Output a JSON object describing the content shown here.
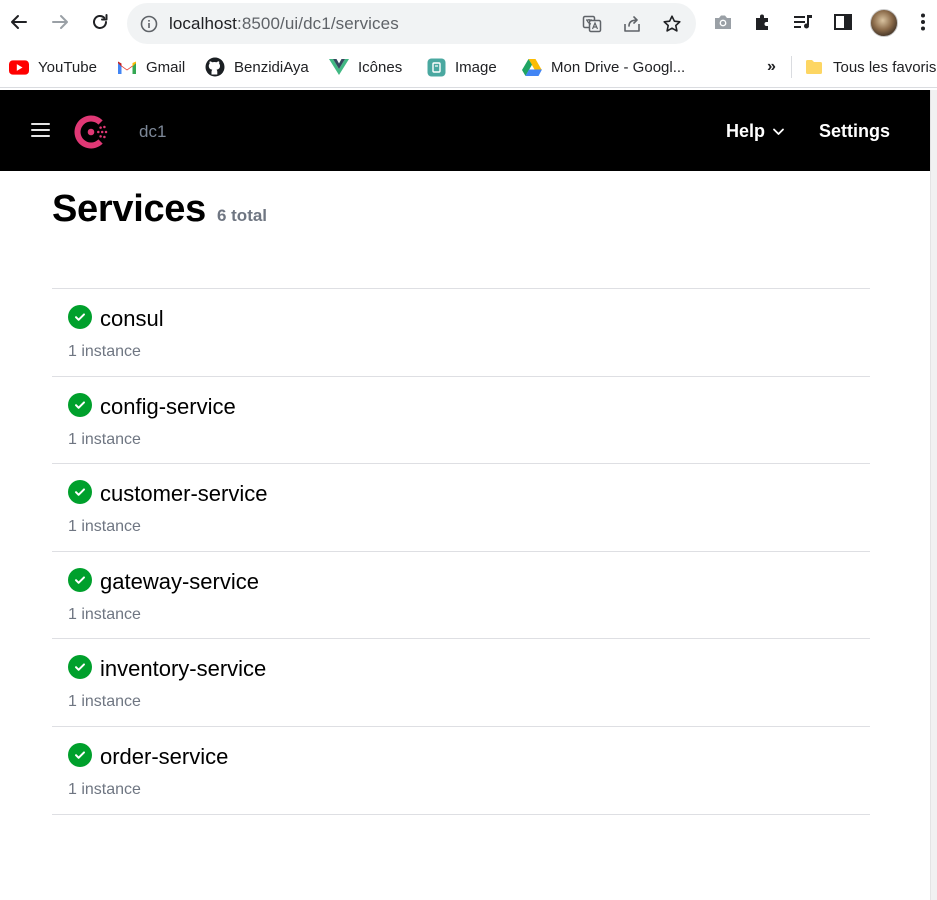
{
  "browser": {
    "url_host": "localhost",
    "url_path": ":8500/ui/dc1/services",
    "bookmarks": [
      {
        "label": "YouTube",
        "icon": "youtube-icon"
      },
      {
        "label": "Gmail",
        "icon": "gmail-icon"
      },
      {
        "label": "BenzidiAya",
        "icon": "github-icon"
      },
      {
        "label": "Icônes",
        "icon": "vue-icon"
      },
      {
        "label": "Image",
        "icon": "image-app-icon"
      },
      {
        "label": "Mon Drive - Googl...",
        "icon": "google-drive-icon"
      }
    ],
    "overflow_label": "»",
    "all_bookmarks_label": "Tous les favoris"
  },
  "header": {
    "datacenter": "dc1",
    "help_label": "Help",
    "settings_label": "Settings"
  },
  "page": {
    "title": "Services",
    "total": "6 total"
  },
  "services": [
    {
      "name": "consul",
      "instances": "1 instance",
      "status": "passing"
    },
    {
      "name": "config-service",
      "instances": "1 instance",
      "status": "passing"
    },
    {
      "name": "customer-service",
      "instances": "1 instance",
      "status": "passing"
    },
    {
      "name": "gateway-service",
      "instances": "1 instance",
      "status": "passing"
    },
    {
      "name": "inventory-service",
      "instances": "1 instance",
      "status": "passing"
    },
    {
      "name": "order-service",
      "instances": "1 instance",
      "status": "passing"
    }
  ],
  "colors": {
    "header_bg": "#000000",
    "brand": "#e03875",
    "passing": "#00a02c"
  }
}
